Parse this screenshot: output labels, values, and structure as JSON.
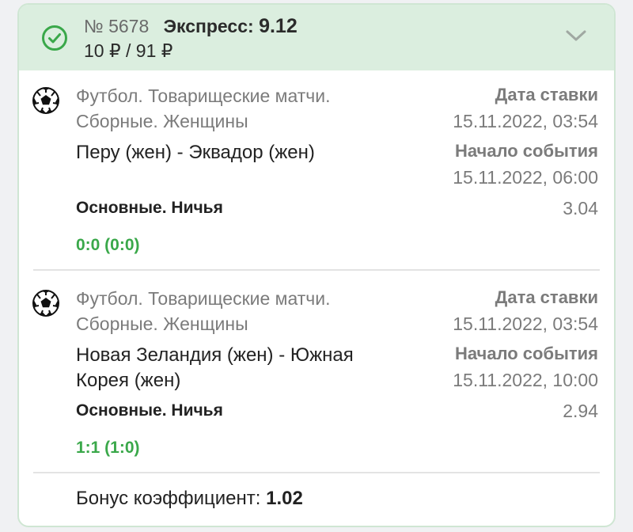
{
  "header": {
    "number": "№ 5678",
    "type_label": "Экспресс:",
    "total_odds": "9.12",
    "stake_payout": "10 ₽ / 91 ₽",
    "status_icon": "check-circle-icon",
    "expand_icon": "chevron-down-icon"
  },
  "bets": [
    {
      "sport_icon": "soccer-ball-icon",
      "league_line1": "Футбол. Товарищеские матчи.",
      "league_line2": "Сборные. Женщины",
      "match_line1": "Перу (жен) - Эквадор (жен)",
      "match_line2": "",
      "bet_date_label": "Дата ставки",
      "bet_date": "15.11.2022, 03:54",
      "event_start_label": "Начало события",
      "event_start": "15.11.2022, 06:00",
      "market": "Основные. Ничья",
      "odds": "3.04",
      "score": "0:0 (0:0)"
    },
    {
      "sport_icon": "soccer-ball-icon",
      "league_line1": "Футбол. Товарищеские матчи.",
      "league_line2": "Сборные. Женщины",
      "match_line1": "Новая Зеландия (жен) - Южная",
      "match_line2": "Корея (жен)",
      "bet_date_label": "Дата ставки",
      "bet_date": "15.11.2022, 03:54",
      "event_start_label": "Начало события",
      "event_start": "15.11.2022, 10:00",
      "market": "Основные. Ничья",
      "odds": "2.94",
      "score": "1:1 (1:0)"
    }
  ],
  "bonus": {
    "label": "Бонус коэффициент:",
    "value": "1.02"
  },
  "colors": {
    "header_bg": "#dbeedf",
    "accent_green": "#3aa84a",
    "muted_text": "#7b7b7b"
  }
}
